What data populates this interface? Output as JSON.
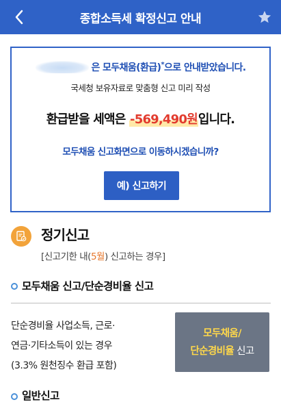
{
  "header": {
    "title": "종합소득세 확정신고 안내",
    "accent_color": "#2f62c7",
    "back_icon": "chevron-left-icon",
    "favorite_icon": "star-icon"
  },
  "notice": {
    "line1_text": "은 모두채움(환급)",
    "line1_mark": "*",
    "line1_suffix": "으로 안내받았습니다.",
    "line2": "국세청 보유자료로 맞춤형 신고 미리 작성",
    "line3_prefix": "환급받을 세액은 ",
    "refund_amount": "-569,490원",
    "line3_suffix": "입니다.",
    "question": "모두채움 신고화면으로 이동하시겠습니까?",
    "confirm_button": "예) 신고하기"
  },
  "section": {
    "title": "정기신고",
    "subtitle_prefix": "[신고기한 내(",
    "subtitle_highlight": "5월",
    "subtitle_suffix": ") 신고하는 경우]",
    "icon": "document-check-icon"
  },
  "item1": {
    "heading": "모두채움 신고/단순경비율 신고",
    "desc_lines": [
      "단순경비율 사업소득, 근로·",
      "연금·기타소득이 있는 경우",
      "(3.3% 원천징수 환급 포함)"
    ],
    "button_line1": "모두채움/",
    "button_line2_highlight": "단순경비율",
    "button_line2_suffix": " 신고"
  },
  "item2": {
    "heading": "일반신고"
  }
}
